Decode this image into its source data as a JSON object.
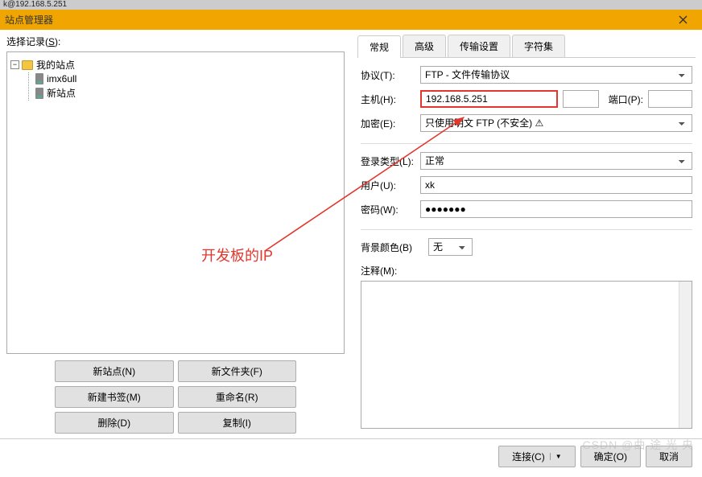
{
  "tinyHeader": "k@192.168.5.251",
  "window": {
    "title": "站点管理器"
  },
  "leftPanel": {
    "selectLabel": "选择记录(",
    "selectKey": "S",
    "selectLabelEnd": "):",
    "tree": {
      "root": "我的站点",
      "items": [
        "imx6ull",
        "新站点"
      ]
    },
    "buttons": {
      "newSite": "新站点(N)",
      "newFolder": "新文件夹(F)",
      "newBookmark": "新建书签(M)",
      "rename": "重命名(R)",
      "delete": "删除(D)",
      "copy": "复制(I)"
    }
  },
  "rightPanel": {
    "tabs": {
      "general": "常规",
      "advanced": "高级",
      "transfer": "传输设置",
      "charset": "字符集"
    },
    "form": {
      "protocolLabel": "协议(T):",
      "protocolValue": "FTP - 文件传输协议",
      "hostLabel": "主机(H):",
      "hostValue": "192.168.5.251",
      "portLabel": "端口(P):",
      "portValue": "",
      "encryptionLabel": "加密(E):",
      "encryptionValue": "只使用明文 FTP (不安全) ⚠",
      "logonTypeLabel": "登录类型(L):",
      "logonTypeValue": "正常",
      "userLabel": "用户(U):",
      "userValue": "xk",
      "passwordLabel": "密码(W):",
      "passwordValue": "●●●●●●●",
      "bgColorLabel": "背景颜色(B)",
      "bgColorValue": "无",
      "commentLabel": "注释(M):"
    }
  },
  "annotation": "开发板的IP",
  "footer": {
    "connect": "连接(C)",
    "ok": "确定(O)",
    "cancel": "取消"
  },
  "watermark": "CSDN @曲 途 光 央"
}
